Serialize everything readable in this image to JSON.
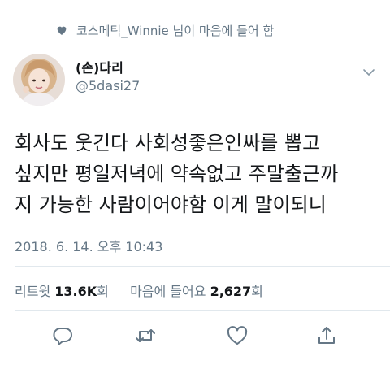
{
  "social_context": {
    "text": "코스메틱_Winnie 님이 마음에 들어 함",
    "icon": "heart-icon"
  },
  "author": {
    "name": "(손)다리",
    "handle": "@5dasi27",
    "avatar_icon": "avatar"
  },
  "tweet": {
    "lines": [
      "회사도 웃긴다 사회성좋은인싸를 뽑고",
      "싶지만 평일저녁에 약속없고 주말출근까",
      "지 가능한 사람이어야함 이게 말이되니"
    ],
    "timestamp": "2018. 6. 14. 오후 10:43"
  },
  "stats": {
    "retweet_label": "리트윗",
    "retweet_count": "13.6K",
    "retweet_unit": "회",
    "like_label": "마음에 들어요",
    "like_count": "2,627",
    "like_unit": "회"
  },
  "actions": [
    "reply-icon",
    "retweet-icon",
    "like-icon",
    "share-icon"
  ],
  "colors": {
    "text": "#14171a",
    "secondary": "#657786",
    "divider": "#e1e8ed",
    "icon": "#657786"
  }
}
